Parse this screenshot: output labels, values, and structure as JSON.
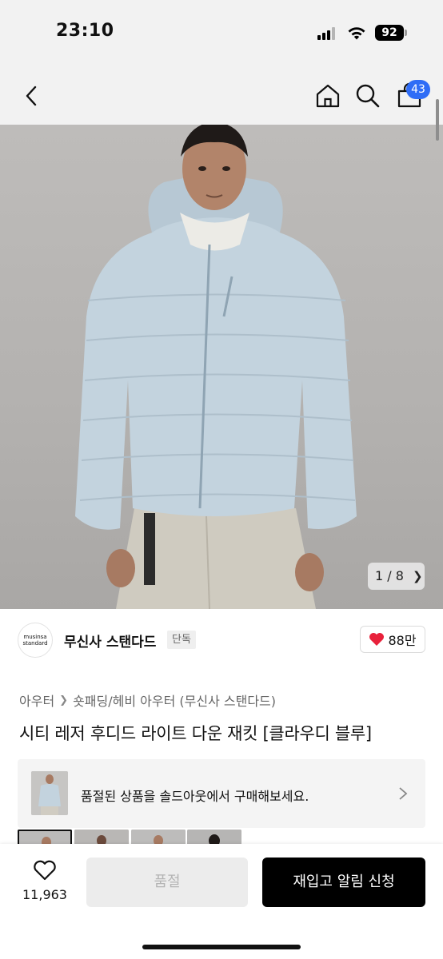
{
  "status_bar": {
    "time": "23:10",
    "battery": "92"
  },
  "nav": {
    "cart_count": "43"
  },
  "gallery": {
    "counter": "1 / 8"
  },
  "brand": {
    "logo_line1": "musinsa",
    "logo_line2": "standard",
    "name": "무신사 스탠다드",
    "tag": "단독"
  },
  "likes": {
    "count": "88만",
    "color": "#e8213b"
  },
  "breadcrumb": {
    "category": "아우터",
    "subcategory": "숏패딩/헤비 아우터 (무신사 스탠다드)"
  },
  "product": {
    "title": "시티 레저 후디드 라이트 다운 재킷 [클라우디 블루]"
  },
  "soldout_banner": {
    "text": "품절된 상품을 솔드아웃에서 구매해보세요."
  },
  "bottom_bar": {
    "wish_count": "11,963",
    "soldout_label": "품절",
    "restock_label": "재입고 알림 신청"
  },
  "colors": {
    "accent_badge": "#2f6df6",
    "primary_button": "#000000",
    "jacket": "#c3d3de"
  }
}
